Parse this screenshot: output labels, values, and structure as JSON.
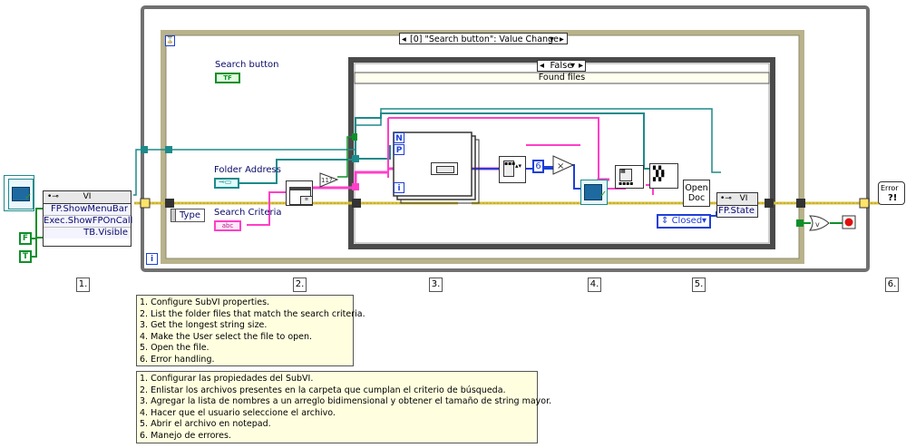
{
  "event_structure": {
    "selector_label": "[0] \"Search button\": Value Change",
    "type_label": "Type"
  },
  "case_structure": {
    "selector_label": "False",
    "subdiagram_label": "Found files"
  },
  "controls": {
    "search_button_label": "Search button",
    "search_button_terminal": "TF",
    "folder_address_label": "Folder Address",
    "search_criteria_label": "Search Criteria",
    "search_criteria_terminal": "abc"
  },
  "property_node_vi": {
    "header": "VI",
    "properties": [
      "FP.ShowMenuBar",
      "Exec.ShowFPOnCall",
      "TB.Visible"
    ]
  },
  "constants": {
    "false_const": "F",
    "true_const": "T",
    "six_const": "6",
    "closed_enum": "Closed"
  },
  "open_doc": {
    "line1": "Open",
    "line2": "Doc"
  },
  "property_node_state": {
    "header": "VI",
    "properties": [
      "FP.State"
    ]
  },
  "for_loop": {
    "n_label": "N",
    "p_label": "P",
    "i_label": "i"
  },
  "while_loop": {
    "i_label": "i"
  },
  "error_handler_label": "Error",
  "step_numbers": [
    "1.",
    "2.",
    "3.",
    "4.",
    "5.",
    "6."
  ],
  "comments": {
    "english": [
      "1. Configure SubVI properties.",
      "2. List the folder files that match the search criteria.",
      "3. Get the longest string size.",
      "4. Make the User select the file to open.",
      "5. Open the file.",
      "6. Error handling."
    ],
    "spanish": [
      "1. Configurar las propiedades del SubVI.",
      "2. Enlistar los archivos presentes en la carpeta que cumplan el criterio de búsqueda.",
      "3. Agregar la lista de nombres a un arreglo bidimensional y obtener el tamaño de string mayor.",
      "4. Hacer que el usuario seleccione el archivo.",
      "5. Abrir el archivo en notepad.",
      "6. Manejo de errores."
    ]
  },
  "colors": {
    "error_wire": "#d9c23a",
    "string_wire": "#ff3fc8",
    "path_wire": "#1e8a8a",
    "boolean_wire": "#0f8f2a",
    "numeric_wire": "#1e3fd8",
    "structure_frame": "#b9b38c",
    "while_loop_frame": "#707070"
  }
}
